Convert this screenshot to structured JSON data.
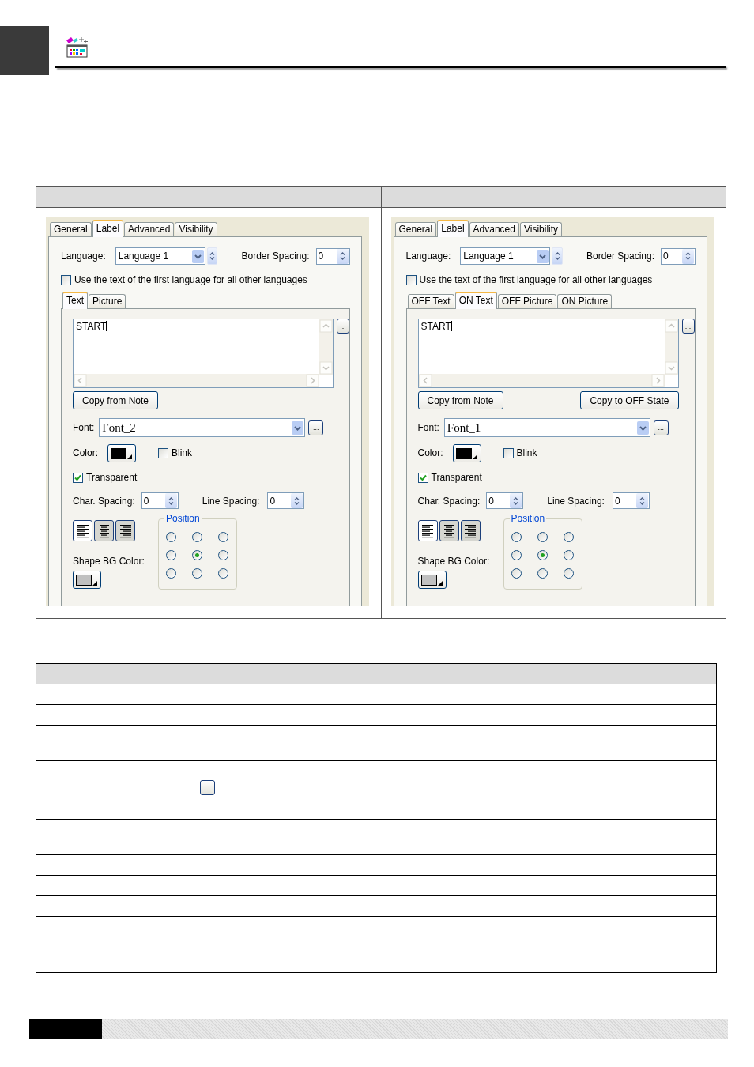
{
  "comparison": {
    "panels": [
      {
        "tabs": [
          {
            "label": "General",
            "selected": false
          },
          {
            "label": "Label",
            "selected": true
          },
          {
            "label": "Advanced",
            "selected": false
          },
          {
            "label": "Visibility",
            "selected": false
          }
        ],
        "language": {
          "label": "Language:",
          "value": "Language 1"
        },
        "border_spacing": {
          "label": "Border Spacing:",
          "value": "0"
        },
        "same_text": {
          "label": "Use the text of the first language for all other languages",
          "checked": false
        },
        "subtabs": [
          {
            "label": "Text",
            "selected": true
          },
          {
            "label": "Picture",
            "selected": false
          }
        ],
        "text": "START",
        "text_more": "...",
        "buttons": [
          "Copy from Note"
        ],
        "font": {
          "label": "Font:",
          "value": "Font_2",
          "more": "..."
        },
        "color": {
          "label": "Color:",
          "color": "#000000"
        },
        "blink": {
          "label": "Blink",
          "checked": false
        },
        "transparent": {
          "label": "Transparent",
          "checked": true
        },
        "char_spacing": {
          "label": "Char. Spacing:",
          "value": "0"
        },
        "line_spacing": {
          "label": "Line Spacing:",
          "value": "0"
        },
        "alignment": [
          {
            "kind": "left",
            "selected": true
          },
          {
            "kind": "center",
            "selected": false
          },
          {
            "kind": "right",
            "selected": false
          }
        ],
        "position": {
          "label": "Position",
          "options": [
            {
              "selected": false
            },
            {
              "selected": false
            },
            {
              "selected": false
            },
            {
              "selected": false
            },
            {
              "selected": true
            },
            {
              "selected": false
            },
            {
              "selected": false
            },
            {
              "selected": false
            },
            {
              "selected": false
            }
          ]
        },
        "shape_bg_color": {
          "label": "Shape BG Color:",
          "color": "#c0c0c0"
        }
      },
      {
        "tabs": [
          {
            "label": "General",
            "selected": false
          },
          {
            "label": "Label",
            "selected": true
          },
          {
            "label": "Advanced",
            "selected": false
          },
          {
            "label": "Visibility",
            "selected": false
          }
        ],
        "language": {
          "label": "Language:",
          "value": "Language 1"
        },
        "border_spacing": {
          "label": "Border Spacing:",
          "value": "0"
        },
        "same_text": {
          "label": "Use the text of the first language for all other languages",
          "checked": false
        },
        "subtabs": [
          {
            "label": "OFF Text",
            "selected": false
          },
          {
            "label": "ON Text",
            "selected": true
          },
          {
            "label": "OFF Picture",
            "selected": false
          },
          {
            "label": "ON Picture",
            "selected": false
          }
        ],
        "text": "START",
        "text_more": "...",
        "buttons": [
          "Copy from Note",
          "Copy to OFF State"
        ],
        "font": {
          "label": "Font:",
          "value": "Font_1",
          "more": "..."
        },
        "color": {
          "label": "Color:",
          "color": "#000000"
        },
        "blink": {
          "label": "Blink",
          "checked": false
        },
        "transparent": {
          "label": "Transparent",
          "checked": true
        },
        "char_spacing": {
          "label": "Char. Spacing:",
          "value": "0"
        },
        "line_spacing": {
          "label": "Line Spacing:",
          "value": "0"
        },
        "alignment": [
          {
            "kind": "left",
            "selected": true
          },
          {
            "kind": "center",
            "selected": false
          },
          {
            "kind": "right",
            "selected": false
          }
        ],
        "position": {
          "label": "Position",
          "options": [
            {
              "selected": false
            },
            {
              "selected": false
            },
            {
              "selected": false
            },
            {
              "selected": false
            },
            {
              "selected": true
            },
            {
              "selected": false
            },
            {
              "selected": false
            },
            {
              "selected": false
            },
            {
              "selected": false
            }
          ]
        },
        "shape_bg_color": {
          "label": "Shape BG Color:",
          "color": "#c0c0c0"
        }
      }
    ]
  },
  "description_table": {
    "rows": [
      {
        "kind": "short"
      },
      {
        "kind": "short"
      },
      {
        "kind": "tall"
      },
      {
        "kind": "icon",
        "button": "..."
      },
      {
        "kind": "tall"
      },
      {
        "kind": "short"
      },
      {
        "kind": "short"
      },
      {
        "kind": "short"
      },
      {
        "kind": "short"
      },
      {
        "kind": "tall"
      }
    ]
  }
}
